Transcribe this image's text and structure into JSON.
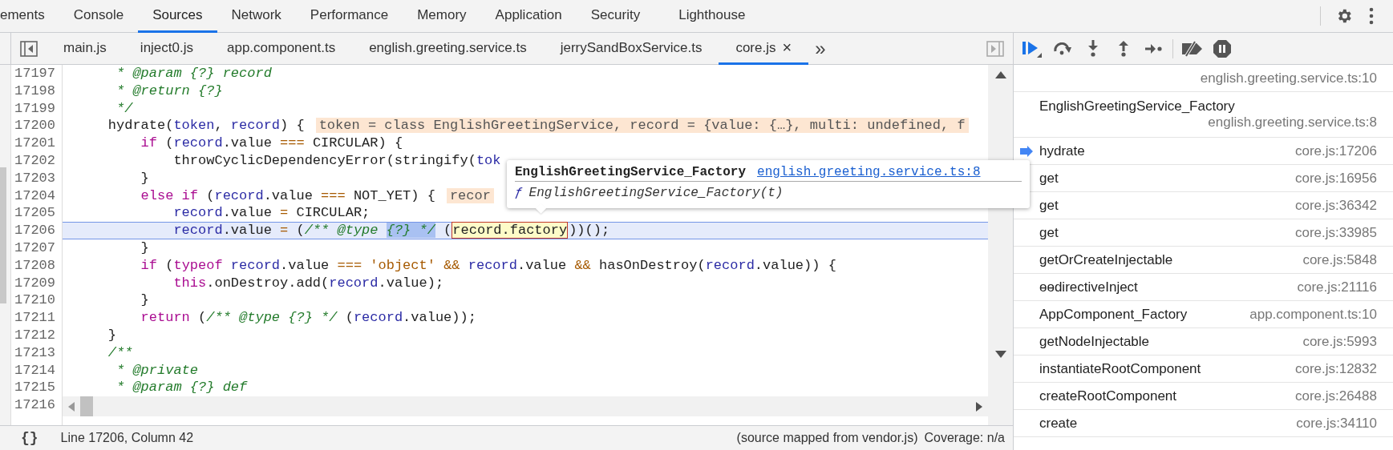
{
  "main_tabs": [
    {
      "label": "ements",
      "selected": false
    },
    {
      "label": "Console",
      "selected": false
    },
    {
      "label": "Sources",
      "selected": true
    },
    {
      "label": "Network",
      "selected": false
    },
    {
      "label": "Performance",
      "selected": false
    },
    {
      "label": "Memory",
      "selected": false
    },
    {
      "label": "Application",
      "selected": false
    },
    {
      "label": "Security",
      "selected": false
    },
    {
      "label": "Lighthouse",
      "selected": false
    }
  ],
  "file_tabs": [
    {
      "label": "main.js",
      "selected": false,
      "closable": false
    },
    {
      "label": "inject0.js",
      "selected": false,
      "closable": false
    },
    {
      "label": "app.component.ts",
      "selected": false,
      "closable": false
    },
    {
      "label": "english.greeting.service.ts",
      "selected": false,
      "closable": false
    },
    {
      "label": "jerrySandBoxService.ts",
      "selected": false,
      "closable": false
    },
    {
      "label": "core.js",
      "selected": true,
      "closable": true
    }
  ],
  "file_tabs_close": "×",
  "file_tabs_more": "»",
  "code": {
    "lines": [
      {
        "number": "17197",
        "current": false,
        "segments": [
          {
            "kind": "comment",
            "text": "     * @param {?} record"
          }
        ]
      },
      {
        "number": "17198",
        "current": false,
        "segments": [
          {
            "kind": "comment",
            "text": "     * @return {?}"
          }
        ]
      },
      {
        "number": "17199",
        "current": false,
        "segments": [
          {
            "kind": "comment",
            "text": "     */"
          }
        ]
      },
      {
        "number": "17200",
        "current": false,
        "segments": [
          {
            "kind": "plain",
            "text": "    hydrate("
          },
          {
            "kind": "param",
            "text": "token"
          },
          {
            "kind": "plain",
            "text": ", "
          },
          {
            "kind": "param",
            "text": "record"
          },
          {
            "kind": "plain",
            "text": ") {"
          }
        ],
        "annotation": "token = class EnglishGreetingService, record = {value: {…}, multi: undefined, f"
      },
      {
        "number": "17201",
        "current": false,
        "segments": [
          {
            "kind": "keyword",
            "text": "        if"
          },
          {
            "kind": "plain",
            "text": " ("
          },
          {
            "kind": "param",
            "text": "record"
          },
          {
            "kind": "plain",
            "text": ".value "
          },
          {
            "kind": "operator",
            "text": "==="
          },
          {
            "kind": "plain",
            "text": " CIRCULAR) {"
          }
        ]
      },
      {
        "number": "17202",
        "current": false,
        "segments": [
          {
            "kind": "plain",
            "text": "            throwCyclicDependencyError(stringify("
          },
          {
            "kind": "param",
            "text": "tok"
          }
        ]
      },
      {
        "number": "17203",
        "current": false,
        "segments": [
          {
            "kind": "plain",
            "text": "        }"
          }
        ]
      },
      {
        "number": "17204",
        "current": false,
        "segments": [
          {
            "kind": "keyword",
            "text": "        else if"
          },
          {
            "kind": "plain",
            "text": " ("
          },
          {
            "kind": "param",
            "text": "record"
          },
          {
            "kind": "plain",
            "text": ".value "
          },
          {
            "kind": "operator",
            "text": "==="
          },
          {
            "kind": "plain",
            "text": " NOT_YET) {"
          }
        ],
        "annotation": "recor"
      },
      {
        "number": "17205",
        "current": false,
        "segments": [
          {
            "kind": "param",
            "text": "            record"
          },
          {
            "kind": "plain",
            "text": ".value "
          },
          {
            "kind": "operator",
            "text": "="
          },
          {
            "kind": "plain",
            "text": " CIRCULAR;"
          }
        ]
      },
      {
        "number": "17206",
        "current": true,
        "segments": [
          {
            "kind": "param",
            "text": "            record"
          },
          {
            "kind": "plain",
            "text": ".value "
          },
          {
            "kind": "operator",
            "text": "="
          },
          {
            "kind": "plain",
            "text": " ("
          },
          {
            "kind": "comment",
            "text": "/** @type "
          },
          {
            "kind": "selection",
            "text": "{?} */"
          },
          {
            "kind": "plain",
            "text": " ("
          },
          {
            "kind": "hover",
            "text": "record.factory"
          },
          {
            "kind": "plain",
            "text": "))();"
          }
        ]
      },
      {
        "number": "17207",
        "current": false,
        "segments": [
          {
            "kind": "plain",
            "text": "        }"
          }
        ]
      },
      {
        "number": "17208",
        "current": false,
        "segments": [
          {
            "kind": "keyword",
            "text": "        if"
          },
          {
            "kind": "plain",
            "text": " ("
          },
          {
            "kind": "keyword",
            "text": "typeof "
          },
          {
            "kind": "param",
            "text": "record"
          },
          {
            "kind": "plain",
            "text": ".value "
          },
          {
            "kind": "operator",
            "text": "=== "
          },
          {
            "kind": "string",
            "text": "'object' "
          },
          {
            "kind": "operator",
            "text": "&& "
          },
          {
            "kind": "param",
            "text": "record"
          },
          {
            "kind": "plain",
            "text": ".value "
          },
          {
            "kind": "operator",
            "text": "&& "
          },
          {
            "kind": "plain",
            "text": "hasOnDestroy("
          },
          {
            "kind": "param",
            "text": "record"
          },
          {
            "kind": "plain",
            "text": ".value)) {"
          }
        ]
      },
      {
        "number": "17209",
        "current": false,
        "segments": [
          {
            "kind": "keyword",
            "text": "            this"
          },
          {
            "kind": "plain",
            "text": ".onDestroy.add("
          },
          {
            "kind": "param",
            "text": "record"
          },
          {
            "kind": "plain",
            "text": ".value);"
          }
        ]
      },
      {
        "number": "17210",
        "current": false,
        "segments": [
          {
            "kind": "plain",
            "text": "        }"
          }
        ]
      },
      {
        "number": "17211",
        "current": false,
        "segments": [
          {
            "kind": "keyword",
            "text": "        return"
          },
          {
            "kind": "plain",
            "text": " ("
          },
          {
            "kind": "comment",
            "text": "/** @type {?} */"
          },
          {
            "kind": "plain",
            "text": " ("
          },
          {
            "kind": "param",
            "text": "record"
          },
          {
            "kind": "plain",
            "text": ".value));"
          }
        ]
      },
      {
        "number": "17212",
        "current": false,
        "segments": [
          {
            "kind": "plain",
            "text": "    }"
          }
        ]
      },
      {
        "number": "17213",
        "current": false,
        "segments": [
          {
            "kind": "comment",
            "text": "    /**"
          }
        ]
      },
      {
        "number": "17214",
        "current": false,
        "segments": [
          {
            "kind": "comment",
            "text": "     * @private"
          }
        ]
      },
      {
        "number": "17215",
        "current": false,
        "segments": [
          {
            "kind": "comment",
            "text": "     * @param {?} def"
          }
        ]
      },
      {
        "number": "17216"
      }
    ]
  },
  "tooltip": {
    "title": "EnglishGreetingService_Factory",
    "link": "english.greeting.service.ts:8",
    "symbol": "ƒ",
    "signature": "EnglishGreetingService_Factory(t)"
  },
  "status_bar": {
    "format_button": "{}",
    "position": "Line 17206, Column 42",
    "source_map": "(source mapped from vendor.js)",
    "coverage": "Coverage: n/a"
  },
  "call_stack": [
    {
      "location": "english.greeting.service.ts:10",
      "current": false,
      "wrap": false
    },
    {
      "name": "EnglishGreetingService_Factory",
      "location": "english.greeting.service.ts:8",
      "current": false,
      "wrap": true
    },
    {
      "name": "hydrate",
      "location": "core.js:17206",
      "current": true,
      "wrap": false
    },
    {
      "name": "get",
      "location": "core.js:16956",
      "current": false,
      "wrap": false
    },
    {
      "name": "get",
      "location": "core.js:36342",
      "current": false,
      "wrap": false
    },
    {
      "name": "get",
      "location": "core.js:33985",
      "current": false,
      "wrap": false
    },
    {
      "name": "getOrCreateInjectable",
      "location": "core.js:5848",
      "current": false,
      "wrap": false
    },
    {
      "name": "ɵɵdirectiveInject",
      "location": "core.js:21116",
      "current": false,
      "wrap": false
    },
    {
      "name": "AppComponent_Factory",
      "location": "app.component.ts:10",
      "current": false,
      "wrap": false
    },
    {
      "name": "getNodeInjectable",
      "location": "core.js:5993",
      "current": false,
      "wrap": false
    },
    {
      "name": "instantiateRootComponent",
      "location": "core.js:12832",
      "current": false,
      "wrap": false
    },
    {
      "name": "createRootComponent",
      "location": "core.js:26488",
      "current": false,
      "wrap": false
    },
    {
      "name": "create",
      "location": "core.js:34110",
      "current": false,
      "wrap": false
    }
  ]
}
